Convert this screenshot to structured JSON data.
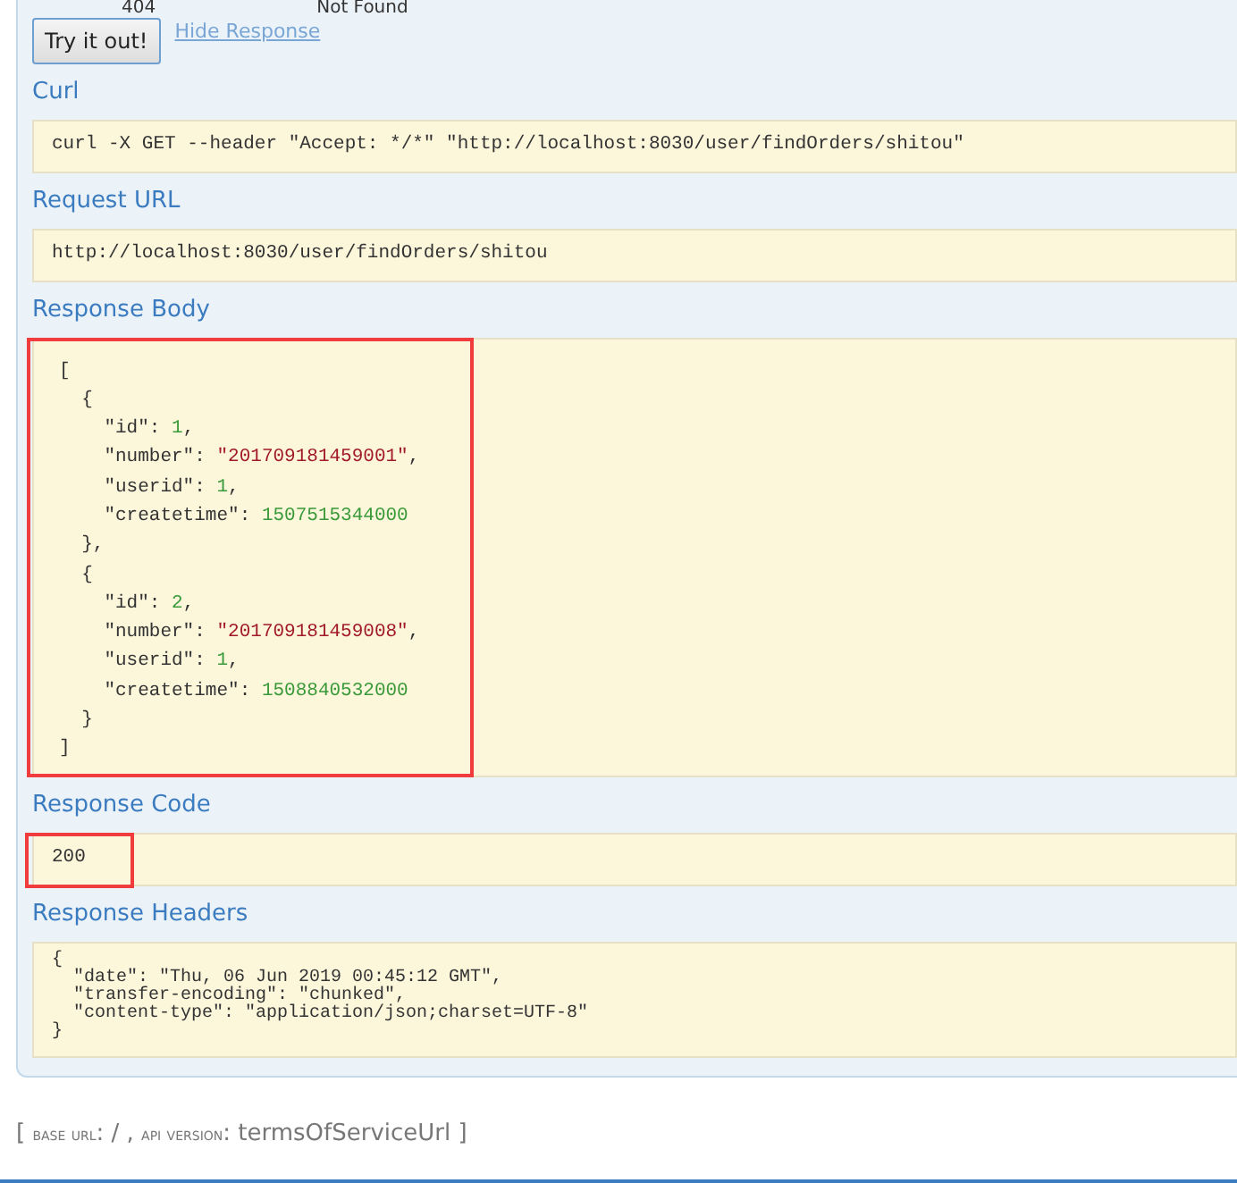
{
  "status_row": {
    "code": "404",
    "message": "Not Found"
  },
  "try_button": {
    "label": "Try it out!"
  },
  "hide_link": {
    "label": "Hide Response"
  },
  "sections": [
    {
      "kind": "plain",
      "title": "Curl",
      "lines": [
        "curl -X GET --header \"Accept: */*\" \"http://localhost:8030/user/findOrders/shitou\""
      ],
      "highlighted": false
    },
    {
      "kind": "plain",
      "title": "Request URL",
      "lines": [
        "http://localhost:8030/user/findOrders/shitou"
      ],
      "highlighted": false
    },
    {
      "kind": "json",
      "title": "Response Body",
      "highlighted": true,
      "lines": [
        [
          {
            "kind": "punct",
            "text": "["
          }
        ],
        [
          {
            "kind": "punct",
            "text": "  {"
          }
        ],
        [
          {
            "kind": "key",
            "text": "    \"id\""
          },
          {
            "kind": "punct",
            "text": ": "
          },
          {
            "kind": "number",
            "text": "1"
          },
          {
            "kind": "punct",
            "text": ","
          }
        ],
        [
          {
            "kind": "key",
            "text": "    \"number\""
          },
          {
            "kind": "punct",
            "text": ": "
          },
          {
            "kind": "string",
            "text": "\"201709181459001\""
          },
          {
            "kind": "punct",
            "text": ","
          }
        ],
        [
          {
            "kind": "key",
            "text": "    \"userid\""
          },
          {
            "kind": "punct",
            "text": ": "
          },
          {
            "kind": "number",
            "text": "1"
          },
          {
            "kind": "punct",
            "text": ","
          }
        ],
        [
          {
            "kind": "key",
            "text": "    \"createtime\""
          },
          {
            "kind": "punct",
            "text": ": "
          },
          {
            "kind": "number",
            "text": "1507515344000"
          }
        ],
        [
          {
            "kind": "punct",
            "text": "  },"
          }
        ],
        [
          {
            "kind": "punct",
            "text": "  {"
          }
        ],
        [
          {
            "kind": "key",
            "text": "    \"id\""
          },
          {
            "kind": "punct",
            "text": ": "
          },
          {
            "kind": "number",
            "text": "2"
          },
          {
            "kind": "punct",
            "text": ","
          }
        ],
        [
          {
            "kind": "key",
            "text": "    \"number\""
          },
          {
            "kind": "punct",
            "text": ": "
          },
          {
            "kind": "string",
            "text": "\"201709181459008\""
          },
          {
            "kind": "punct",
            "text": ","
          }
        ],
        [
          {
            "kind": "key",
            "text": "    \"userid\""
          },
          {
            "kind": "punct",
            "text": ": "
          },
          {
            "kind": "number",
            "text": "1"
          },
          {
            "kind": "punct",
            "text": ","
          }
        ],
        [
          {
            "kind": "key",
            "text": "    \"createtime\""
          },
          {
            "kind": "punct",
            "text": ": "
          },
          {
            "kind": "number",
            "text": "1508840532000"
          }
        ],
        [
          {
            "kind": "punct",
            "text": "  }"
          }
        ],
        [
          {
            "kind": "punct",
            "text": "]"
          }
        ]
      ]
    },
    {
      "kind": "plain",
      "title": "Response Code",
      "lines": [
        "200"
      ],
      "highlighted": true
    },
    {
      "kind": "dense",
      "title": "Response Headers",
      "highlighted": false,
      "lines": [
        "{",
        "  \"date\": \"Thu, 06 Jun 2019 00:45:12 GMT\",",
        "  \"transfer-encoding\": \"chunked\",",
        "  \"content-type\": \"application/json;charset=UTF-8\"",
        "}"
      ]
    }
  ],
  "footer": [
    {
      "kind": "label",
      "text": "base url"
    },
    {
      "kind": "value",
      "text": ": / , "
    },
    {
      "kind": "label",
      "text": "api version"
    },
    {
      "kind": "value",
      "text": ": termsOfServiceUrl ]"
    }
  ],
  "footer_open": "[ "
}
